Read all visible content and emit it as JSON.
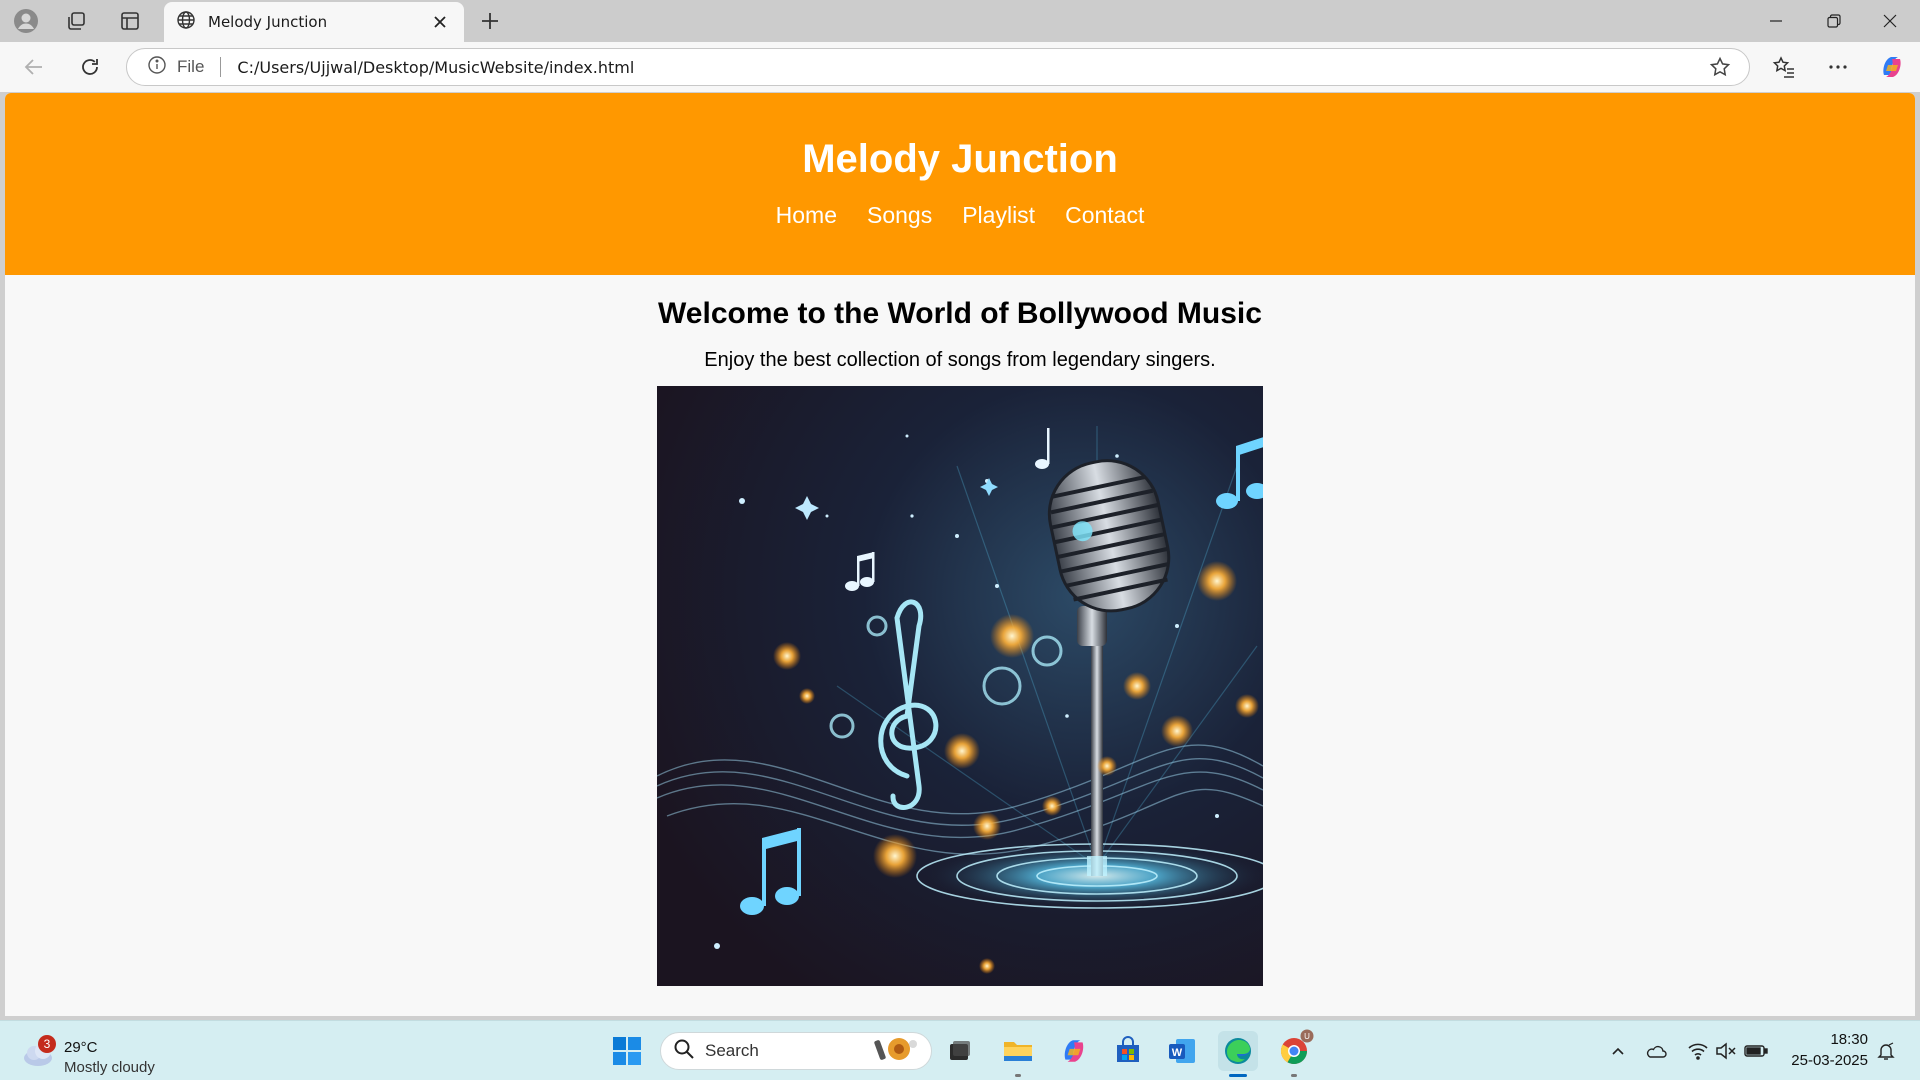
{
  "browser": {
    "tab_title": "Melody Junction",
    "address": {
      "scheme_label": "File",
      "url": "C:/Users/Ujjwal/Desktop/MusicWebsite/index.html"
    }
  },
  "site": {
    "title": "Melody Junction",
    "nav": [
      "Home",
      "Songs",
      "Playlist",
      "Contact"
    ],
    "welcome_heading": "Welcome to the World of Bollywood Music",
    "tagline": "Enjoy the best collection of songs from legendary singers."
  },
  "taskbar": {
    "weather": {
      "badge_count": "3",
      "temperature": "29°C",
      "condition": "Mostly cloudy"
    },
    "search_label": "Search",
    "apps": [
      "start-icon",
      "search-icon",
      "task-view-icon",
      "file-explorer-icon",
      "copilot-icon",
      "store-icon",
      "word-icon",
      "edge-icon",
      "chrome-icon"
    ],
    "clock": {
      "time": "18:30",
      "date": "25-03-2025"
    }
  },
  "colors": {
    "header_orange": "#ff9800",
    "page_background": "#f8f8f8",
    "taskbar": "#d5eef2"
  }
}
